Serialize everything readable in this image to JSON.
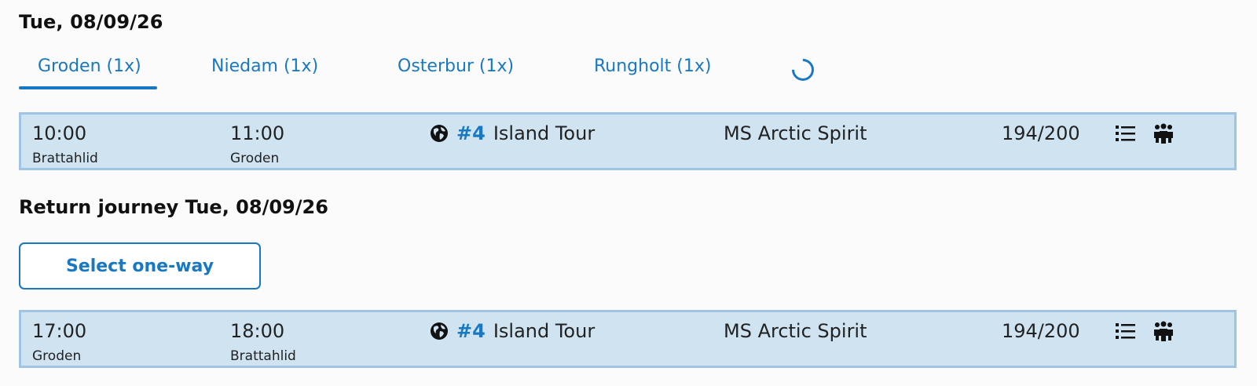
{
  "outbound": {
    "heading": "Tue, 08/09/26",
    "tabs": [
      {
        "label": "Groden (1x)",
        "active": true
      },
      {
        "label": "Niedam (1x)",
        "active": false
      },
      {
        "label": "Osterbur (1x)",
        "active": false
      },
      {
        "label": "Rungholt (1x)",
        "active": false
      }
    ],
    "loading_icon": "spinner-icon",
    "trip": {
      "departure_time": "10:00",
      "departure_place": "Brattahlid",
      "arrival_time": "11:00",
      "arrival_place": "Groden",
      "route_number": "#4",
      "route_name": "Island Tour",
      "ship": "MS Arctic Spirit",
      "capacity": "194/200",
      "icons": [
        "globe-icon",
        "list-icon",
        "people-icon"
      ]
    }
  },
  "return": {
    "heading": "Return journey Tue, 08/09/26",
    "select_label": "Select one-way",
    "trip": {
      "departure_time": "17:00",
      "departure_place": "Groden",
      "arrival_time": "18:00",
      "arrival_place": "Brattahlid",
      "route_number": "#4",
      "route_name": "Island Tour",
      "ship": "MS Arctic Spirit",
      "capacity": "194/200",
      "icons": [
        "globe-icon",
        "list-icon",
        "people-icon"
      ]
    }
  },
  "colors": {
    "accent": "#1878c2",
    "row_background": "#cfe3f1",
    "row_border": "#9fc4e6"
  }
}
